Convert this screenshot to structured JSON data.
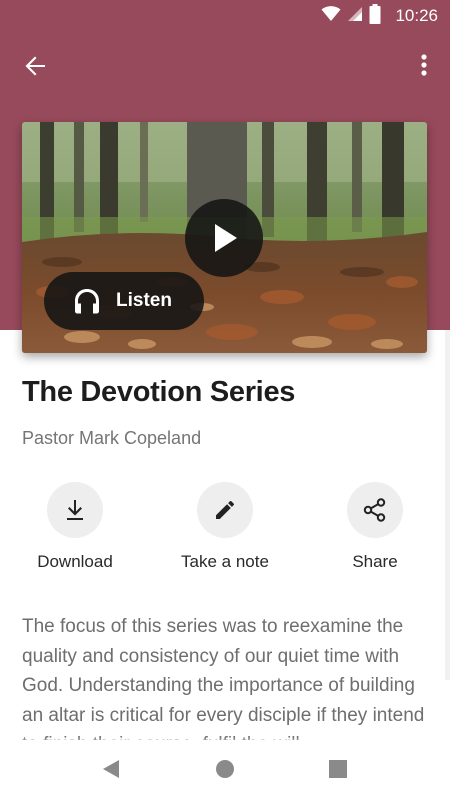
{
  "status_bar": {
    "time": "10:26",
    "icons": [
      "wifi-icon",
      "signal-icon",
      "battery-icon"
    ]
  },
  "toolbar": {
    "back_icon": "arrow-back-icon",
    "more_icon": "more-vert-icon"
  },
  "colors": {
    "header": "#974a5b",
    "accent_circle": "#eeeeee",
    "overlay_button": "#141414"
  },
  "media": {
    "image": "autumn forest floor with leaves and tree trunks",
    "play_icon": "play-icon",
    "listen_label": "Listen",
    "listen_icon": "headphones-icon"
  },
  "series": {
    "title": "The Devotion Series",
    "author": "Pastor Mark Copeland"
  },
  "actions": [
    {
      "label": "Download",
      "icon": "download-icon"
    },
    {
      "label": "Take a note",
      "icon": "pencil-icon"
    },
    {
      "label": "Share",
      "icon": "share-icon"
    }
  ],
  "description": "The focus of this series was to reexamine the quality and consistency of our quiet time with God. Understanding the importance of building an altar is critical for every disciple if they intend to finish their course, fulfil the will",
  "nav_bar": {
    "icons": [
      "back-triangle-icon",
      "home-circle-icon",
      "recents-square-icon"
    ]
  }
}
